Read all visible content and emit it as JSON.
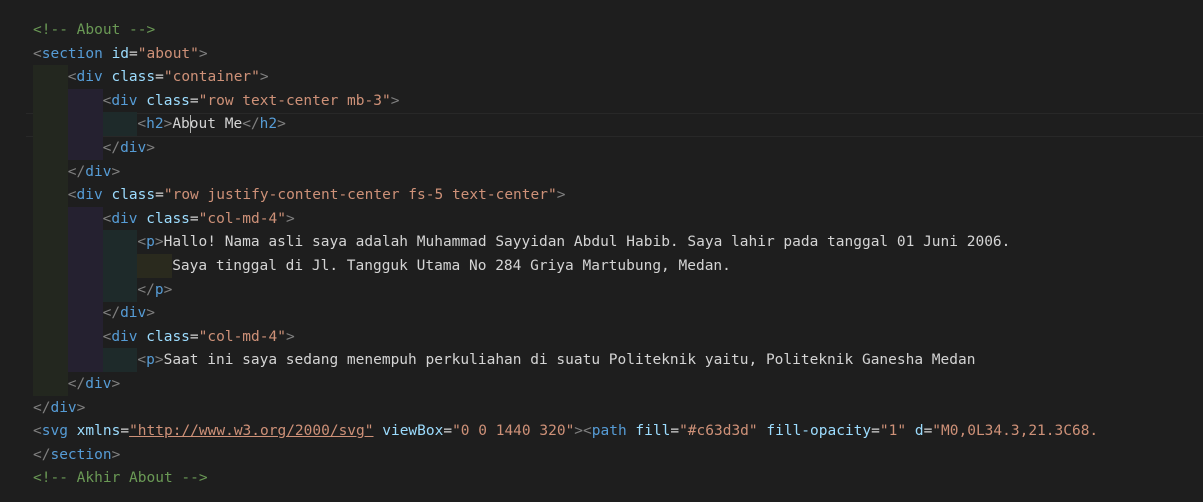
{
  "editor": {
    "lines": [
      {
        "indent": 0,
        "tokens": [
          {
            "k": "c",
            "v": "<!-- About -->"
          }
        ]
      },
      {
        "indent": 0,
        "tokens": [
          {
            "k": "p",
            "v": "<"
          },
          {
            "k": "t",
            "v": "section"
          },
          {
            "k": "a",
            "v": " id"
          },
          {
            "k": "x",
            "v": "="
          },
          {
            "k": "s",
            "v": "\"about\""
          },
          {
            "k": "p",
            "v": ">"
          }
        ]
      },
      {
        "indent": 1,
        "tokens": [
          {
            "k": "p",
            "v": "<"
          },
          {
            "k": "t",
            "v": "div"
          },
          {
            "k": "a",
            "v": " class"
          },
          {
            "k": "x",
            "v": "="
          },
          {
            "k": "s",
            "v": "\"container\""
          },
          {
            "k": "p",
            "v": ">"
          }
        ]
      },
      {
        "indent": 2,
        "tokens": [
          {
            "k": "p",
            "v": "<"
          },
          {
            "k": "t",
            "v": "div"
          },
          {
            "k": "a",
            "v": " class"
          },
          {
            "k": "x",
            "v": "="
          },
          {
            "k": "s",
            "v": "\"row text-center mb-3\""
          },
          {
            "k": "p",
            "v": ">"
          }
        ]
      },
      {
        "indent": 3,
        "current": true,
        "tokens": [
          {
            "k": "p",
            "v": "<"
          },
          {
            "k": "t",
            "v": "h2"
          },
          {
            "k": "p",
            "v": ">"
          },
          {
            "k": "x",
            "v": "Ab"
          },
          {
            "k": "cursor",
            "v": ""
          },
          {
            "k": "x",
            "v": "out Me"
          },
          {
            "k": "p",
            "v": "</"
          },
          {
            "k": "t",
            "v": "h2"
          },
          {
            "k": "p",
            "v": ">"
          }
        ]
      },
      {
        "indent": 2,
        "tokens": [
          {
            "k": "p",
            "v": "</"
          },
          {
            "k": "t",
            "v": "div"
          },
          {
            "k": "p",
            "v": ">"
          }
        ]
      },
      {
        "indent": 1,
        "tokens": [
          {
            "k": "p",
            "v": "</"
          },
          {
            "k": "t",
            "v": "div"
          },
          {
            "k": "p",
            "v": ">"
          }
        ]
      },
      {
        "indent": 1,
        "tokens": [
          {
            "k": "p",
            "v": "<"
          },
          {
            "k": "t",
            "v": "div"
          },
          {
            "k": "a",
            "v": " class"
          },
          {
            "k": "x",
            "v": "="
          },
          {
            "k": "s",
            "v": "\"row justify-content-center fs-5 text-center\""
          },
          {
            "k": "p",
            "v": ">"
          }
        ]
      },
      {
        "indent": 2,
        "tokens": [
          {
            "k": "p",
            "v": "<"
          },
          {
            "k": "t",
            "v": "div"
          },
          {
            "k": "a",
            "v": " class"
          },
          {
            "k": "x",
            "v": "="
          },
          {
            "k": "s",
            "v": "\"col-md-4\""
          },
          {
            "k": "p",
            "v": ">"
          }
        ]
      },
      {
        "indent": 3,
        "tokens": [
          {
            "k": "p",
            "v": "<"
          },
          {
            "k": "t",
            "v": "p"
          },
          {
            "k": "p",
            "v": ">"
          },
          {
            "k": "x",
            "v": "Hallo! Nama asli saya adalah Muhammad Sayyidan Abdul Habib. Saya lahir pada tanggal 01 Juni 2006."
          }
        ]
      },
      {
        "indent": 4,
        "tokens": [
          {
            "k": "x",
            "v": "Saya tinggal di Jl. Tangguk Utama No 284 Griya Martubung, Medan."
          }
        ]
      },
      {
        "indent": 3,
        "tokens": [
          {
            "k": "p",
            "v": "</"
          },
          {
            "k": "t",
            "v": "p"
          },
          {
            "k": "p",
            "v": ">"
          }
        ]
      },
      {
        "indent": 2,
        "tokens": [
          {
            "k": "p",
            "v": "</"
          },
          {
            "k": "t",
            "v": "div"
          },
          {
            "k": "p",
            "v": ">"
          }
        ]
      },
      {
        "indent": 2,
        "tokens": [
          {
            "k": "p",
            "v": "<"
          },
          {
            "k": "t",
            "v": "div"
          },
          {
            "k": "a",
            "v": " class"
          },
          {
            "k": "x",
            "v": "="
          },
          {
            "k": "s",
            "v": "\"col-md-4\""
          },
          {
            "k": "p",
            "v": ">"
          }
        ]
      },
      {
        "indent": 3,
        "tokens": [
          {
            "k": "p",
            "v": "<"
          },
          {
            "k": "t",
            "v": "p"
          },
          {
            "k": "p",
            "v": ">"
          },
          {
            "k": "x",
            "v": "Saat ini saya sedang menempuh perkuliahan di suatu Politeknik yaitu, Politeknik Ganesha Medan"
          }
        ]
      },
      {
        "indent": 1,
        "tokens": [
          {
            "k": "p",
            "v": "</"
          },
          {
            "k": "t",
            "v": "div"
          },
          {
            "k": "p",
            "v": ">"
          }
        ]
      },
      {
        "indent": 0,
        "tokens": [
          {
            "k": "p",
            "v": "</"
          },
          {
            "k": "t",
            "v": "div"
          },
          {
            "k": "p",
            "v": ">"
          }
        ]
      },
      {
        "indent": 0,
        "tokens": [
          {
            "k": "p",
            "v": "<"
          },
          {
            "k": "t",
            "v": "svg"
          },
          {
            "k": "a",
            "v": " xmlns"
          },
          {
            "k": "x",
            "v": "="
          },
          {
            "k": "su",
            "v": "\"http://www.w3.org/2000/svg\""
          },
          {
            "k": "a",
            "v": " viewBox"
          },
          {
            "k": "x",
            "v": "="
          },
          {
            "k": "s",
            "v": "\"0 0 1440 320\""
          },
          {
            "k": "p",
            "v": ">"
          },
          {
            "k": "p",
            "v": "<"
          },
          {
            "k": "t",
            "v": "path"
          },
          {
            "k": "a",
            "v": " fill"
          },
          {
            "k": "x",
            "v": "="
          },
          {
            "k": "s",
            "v": "\"#c63d3d\""
          },
          {
            "k": "a",
            "v": " fill-opacity"
          },
          {
            "k": "x",
            "v": "="
          },
          {
            "k": "s",
            "v": "\"1\""
          },
          {
            "k": "a",
            "v": " d"
          },
          {
            "k": "x",
            "v": "="
          },
          {
            "k": "s",
            "v": "\"M0,0L34.3,21.3C68."
          }
        ]
      },
      {
        "indent": 0,
        "tokens": [
          {
            "k": "p",
            "v": "</"
          },
          {
            "k": "t",
            "v": "section"
          },
          {
            "k": "p",
            "v": ">"
          }
        ]
      },
      {
        "indent": 0,
        "tokens": [
          {
            "k": "c",
            "v": "<!-- Akhir About -->"
          }
        ]
      }
    ]
  },
  "colors": {
    "background": "#1e1e1e",
    "comment": "#6a9955",
    "tag": "#569cd6",
    "attribute": "#9cdcfe",
    "string": "#ce9178",
    "punctuation": "#808080",
    "text": "#d4d4d4"
  }
}
